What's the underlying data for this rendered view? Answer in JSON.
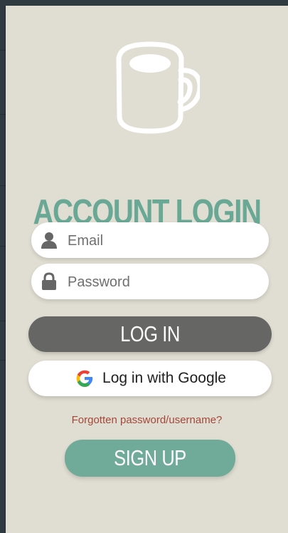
{
  "theme": {
    "background": "#e0ddd2",
    "accent": "#6aa896",
    "login_button": "#666664",
    "signup_button": "#70aa98",
    "forgot_link": "#a34838"
  },
  "header": {
    "logo_icon": "coffee-mug-icon",
    "title": "ACCOUNT LOGIN"
  },
  "form": {
    "email": {
      "placeholder": "Email",
      "icon": "user-icon"
    },
    "password": {
      "placeholder": "Password",
      "icon": "lock-icon"
    }
  },
  "actions": {
    "login_label": "LOG IN",
    "google_label": "Log in with Google",
    "google_icon": "google-icon",
    "forgot_label": "Forgotten password/username?",
    "signup_label": "SIGN UP"
  }
}
